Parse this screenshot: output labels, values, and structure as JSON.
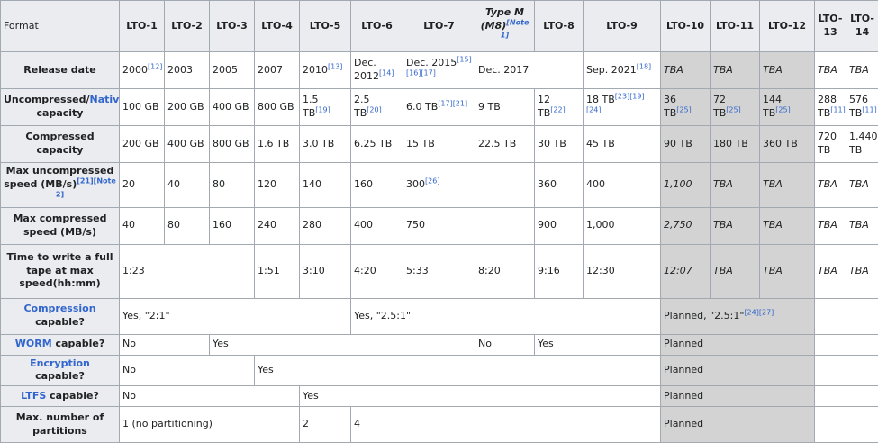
{
  "header": {
    "format": "Format",
    "columns": [
      "LTO-1",
      "LTO-2",
      "LTO-3",
      "LTO-4",
      "LTO-5",
      "LTO-6",
      "LTO-7",
      "Type M (M8)",
      "LTO-8",
      "LTO-9",
      "LTO-10",
      "LTO-11",
      "LTO-12",
      "LTO-13",
      "LTO-14"
    ],
    "note1": "[Note 1]"
  },
  "rows": {
    "release": {
      "label": "Release date",
      "c1": "2000",
      "c1ref": "[12]",
      "c2": "2003",
      "c3": "2005",
      "c4": "2007",
      "c5": "2010",
      "c5ref": "[13]",
      "c6": "Dec. 2012",
      "c6ref": "[14]",
      "c7": "Dec. 2015",
      "c7ref": "[15][16][17]",
      "c8": "Dec. 2017",
      "c10": "Sep. 2021",
      "c10ref": "[18]",
      "c11": "TBA",
      "c12": "TBA",
      "c13": "TBA",
      "c14": "TBA",
      "c15": "TBA"
    },
    "native": {
      "label_pre": "Uncompressed/",
      "label_link": "Native",
      "label_post": "capacity",
      "c1": "100 GB",
      "c2": "200 GB",
      "c3": "400 GB",
      "c4": "800 GB",
      "c5": "1.5 TB",
      "c5ref": "[19]",
      "c6": "2.5 TB",
      "c6ref": "[20]",
      "c7": "6.0 TB",
      "c7ref": "[17][21]",
      "c8": "9 TB",
      "c9": "12 TB",
      "c9ref": "[22]",
      "c10": "18 TB",
      "c10ref": "[23][19][24]",
      "c11": "36 TB",
      "c11ref": "[25]",
      "c12": "72 TB",
      "c12ref": "[25]",
      "c13": "144 TB",
      "c13ref": "[25]",
      "c14": "288 TB",
      "c14ref": "[11]",
      "c15": "576 TB",
      "c15ref": "[11]"
    },
    "compressed": {
      "label": "Compressed capacity",
      "c1": "200 GB",
      "c2": "400 GB",
      "c3": "800 GB",
      "c4": "1.6 TB",
      "c5": "3.0 TB",
      "c6": "6.25 TB",
      "c7": "15 TB",
      "c8": "22.5 TB",
      "c9": "30 TB",
      "c10": "45 TB",
      "c11": "90 TB",
      "c12": "180 TB",
      "c13": "360 TB",
      "c14": "720 TB",
      "c15": "1,440 TB"
    },
    "maxunc": {
      "label": "Max uncompressed speed (MB/s)",
      "labelref": "[21][Note 2]",
      "c1": "20",
      "c2": "40",
      "c3": "80",
      "c4": "120",
      "c5": "140",
      "c6": "160",
      "c7": "300",
      "c7ref": "[26]",
      "c9": "360",
      "c10": "400",
      "c11": "1,100",
      "c12": "TBA",
      "c13": "TBA",
      "c14": "TBA",
      "c15": "TBA"
    },
    "maxcomp": {
      "label": "Max compressed speed (MB/s)",
      "c1": "40",
      "c2": "80",
      "c3": "160",
      "c4": "240",
      "c5": "280",
      "c6": "400",
      "c7": "750",
      "c9": "900",
      "c10": "1,000",
      "c11": "2,750",
      "c12": "TBA",
      "c13": "TBA",
      "c14": "TBA",
      "c15": "TBA"
    },
    "time": {
      "label": "Time to write a full tape at max speed(hh:mm)",
      "c1": "1:23",
      "c4": "1:51",
      "c5": "3:10",
      "c6": "4:20",
      "c7": "5:33",
      "c8": "8:20",
      "c9": "9:16",
      "c10": "12:30",
      "c11": "12:07",
      "c12": "TBA",
      "c13": "TBA",
      "c14": "TBA",
      "c15": "TBA"
    },
    "compression": {
      "label_link": "Compression",
      "label_post": "capable?",
      "a": "Yes, \"2:1\"",
      "b": "Yes, \"2.5:1\"",
      "c": "Planned, \"2.5:1\"",
      "cref": "[24][27]"
    },
    "worm": {
      "label_link": "WORM",
      "label_post": "capable?",
      "a": "No",
      "b": "Yes",
      "c": "No",
      "d": "Yes",
      "e": "Planned"
    },
    "encryption": {
      "label_link": "Encryption",
      "label_post": "capable?",
      "a": "No",
      "b": "Yes",
      "c": "Planned"
    },
    "ltfs": {
      "label_link": "LTFS",
      "label_post": "capable?",
      "a": "No",
      "b": "Yes",
      "c": "Planned"
    },
    "partitions": {
      "label": "Max. number of partitions",
      "a": "1 (no partitioning)",
      "b": "2",
      "c": "4",
      "d": "Planned"
    }
  }
}
